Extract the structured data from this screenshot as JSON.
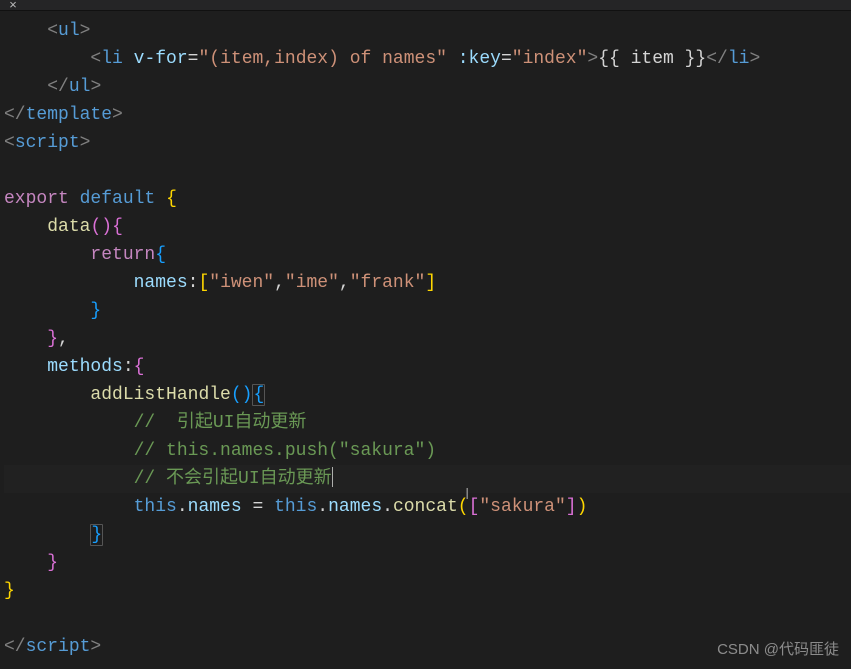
{
  "code": {
    "ul_open": "ul",
    "ul_close": "ul",
    "li_open": "li",
    "li_close": "li",
    "vfor_attr": "v-for",
    "vfor_val": "\"(item,index) of names\"",
    "key_attr": ":key",
    "key_val": "\"index\"",
    "interp": "{{ item }}",
    "template_close": "template",
    "script_open": "script",
    "script_close": "script",
    "export_kw": "export",
    "default_kw": "default",
    "data_fn": "data",
    "return_kw": "return",
    "names_prop": "names",
    "names_colon": ":",
    "names_arr_open": "[",
    "names_v1": "\"iwen\"",
    "names_v2": "\"ime\"",
    "names_v3": "\"frank\"",
    "names_arr_close": "]",
    "methods_prop": "methods",
    "addListHandle": "addListHandle",
    "comment1": "//  引起UI自动更新",
    "comment2": "// this.names.push(\"sakura\")",
    "comment3": "// 不会引起UI自动更新",
    "this_kw": "this",
    "names_ref": "names",
    "eq": " = ",
    "concat_fn": "concat",
    "sakura_str": "\"sakura\"",
    "comma": ","
  },
  "watermark": "CSDN @代码匪徒"
}
